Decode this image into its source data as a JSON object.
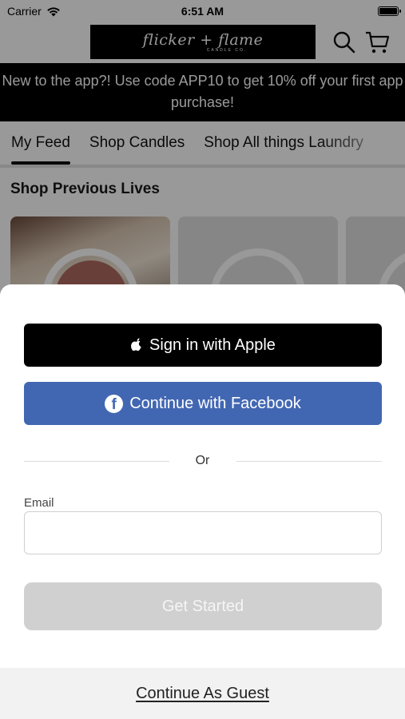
{
  "status_bar": {
    "carrier": "Carrier",
    "time": "6:51 AM"
  },
  "header": {
    "logo_script": "flicker + flame",
    "logo_sub": "CANDLE CO.",
    "search_icon": "search-icon",
    "cart_icon": "cart-icon"
  },
  "promo": {
    "text": "New to the app?! Use code APP10 to get 10% off your first app purchase!"
  },
  "tabs": [
    {
      "label": "My Feed",
      "active": true
    },
    {
      "label": "Shop Candles"
    },
    {
      "label": "Shop All things Laundry"
    }
  ],
  "section": {
    "title": "Shop Previous Lives"
  },
  "sheet": {
    "apple_label": "Sign in with Apple",
    "facebook_label": "Continue with Facebook",
    "divider": "Or",
    "email_label": "Email",
    "email_value": "",
    "get_started_label": "Get Started",
    "guest_label": "Continue As Guest"
  },
  "colors": {
    "facebook": "#4267b2",
    "apple": "#000000",
    "disabled_button": "#d0d0d0",
    "promo_background": "#000000"
  }
}
